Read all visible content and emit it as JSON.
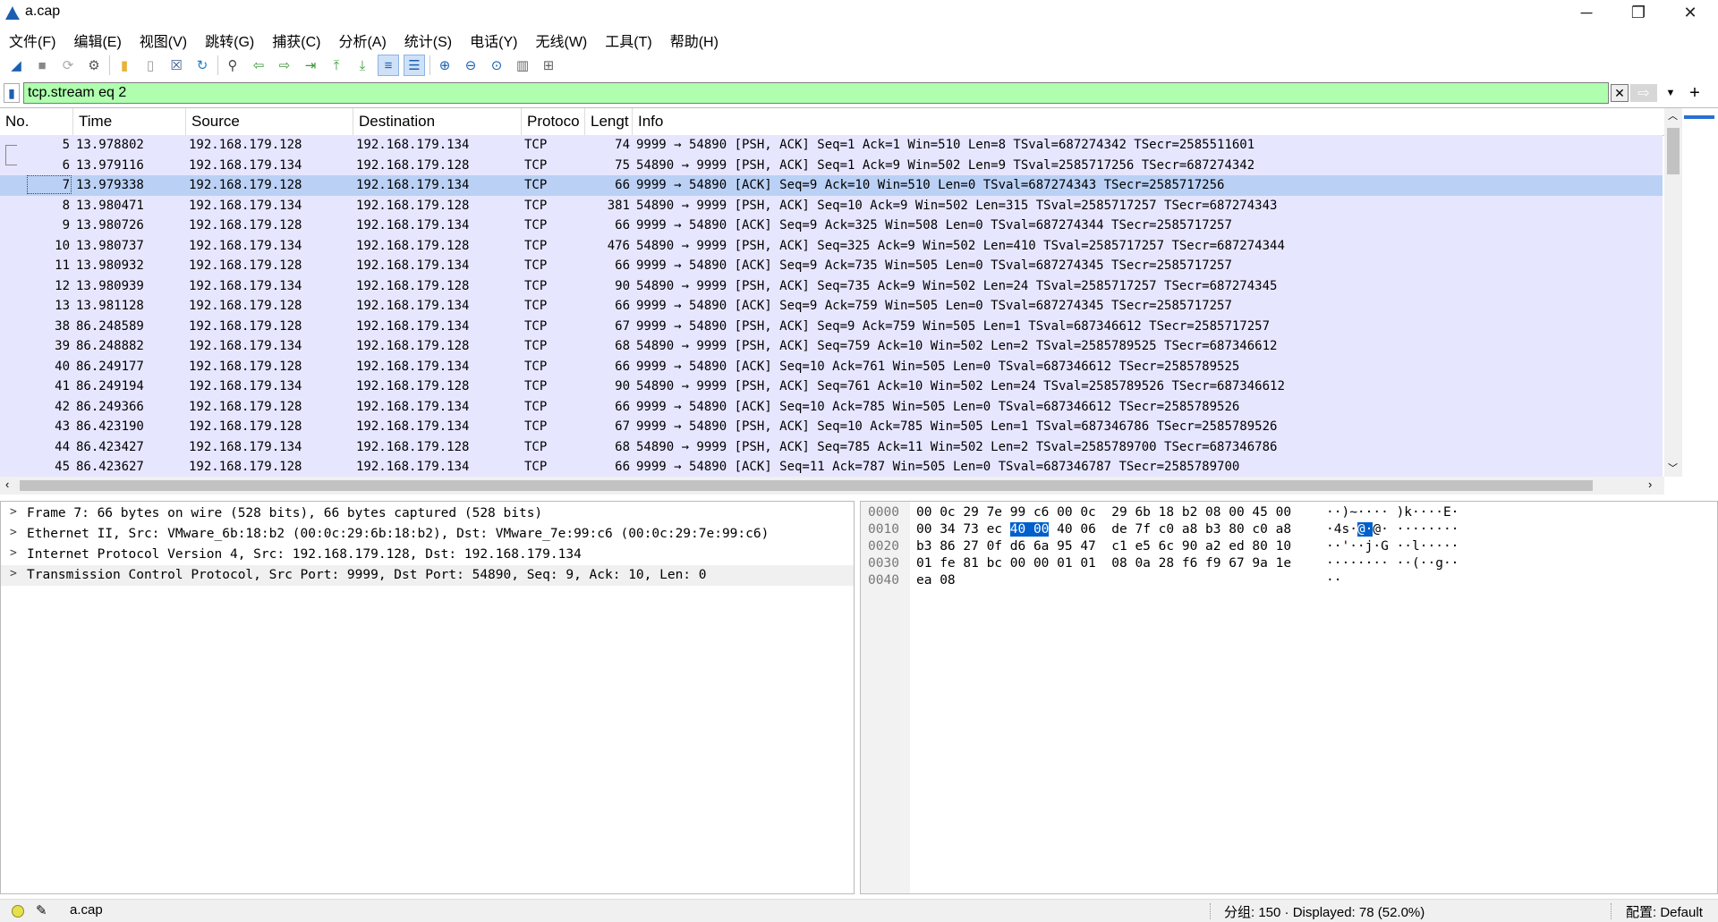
{
  "window": {
    "title": "a.cap"
  },
  "menu": [
    "文件(F)",
    "编辑(E)",
    "视图(V)",
    "跳转(G)",
    "捕获(C)",
    "分析(A)",
    "统计(S)",
    "电话(Y)",
    "无线(W)",
    "工具(T)",
    "帮助(H)"
  ],
  "filter": {
    "value": "tcp.stream eq 2",
    "bg_color": "#afffaf"
  },
  "packet_list": {
    "columns": [
      "No.",
      "Time",
      "Source",
      "Destination",
      "Protoco",
      "Lengt",
      "Info"
    ],
    "row_color": "#e7e6ff",
    "selected_color": "#bad1f5",
    "rows": [
      {
        "no": "5",
        "time": "13.978802",
        "src": "192.168.179.128",
        "dst": "192.168.179.134",
        "proto": "TCP",
        "len": "74",
        "info": "9999 → 54890 [PSH, ACK] Seq=1 Ack=1 Win=510 Len=8 TSval=687274342 TSecr=2585511601"
      },
      {
        "no": "6",
        "time": "13.979116",
        "src": "192.168.179.134",
        "dst": "192.168.179.128",
        "proto": "TCP",
        "len": "75",
        "info": "54890 → 9999 [PSH, ACK] Seq=1 Ack=9 Win=502 Len=9 TSval=2585717256 TSecr=687274342"
      },
      {
        "no": "7",
        "time": "13.979338",
        "src": "192.168.179.128",
        "dst": "192.168.179.134",
        "proto": "TCP",
        "len": "66",
        "info": "9999 → 54890 [ACK] Seq=9 Ack=10 Win=510 Len=0 TSval=687274343 TSecr=2585717256"
      },
      {
        "no": "8",
        "time": "13.980471",
        "src": "192.168.179.134",
        "dst": "192.168.179.128",
        "proto": "TCP",
        "len": "381",
        "info": "54890 → 9999 [PSH, ACK] Seq=10 Ack=9 Win=502 Len=315 TSval=2585717257 TSecr=687274343"
      },
      {
        "no": "9",
        "time": "13.980726",
        "src": "192.168.179.128",
        "dst": "192.168.179.134",
        "proto": "TCP",
        "len": "66",
        "info": "9999 → 54890 [ACK] Seq=9 Ack=325 Win=508 Len=0 TSval=687274344 TSecr=2585717257"
      },
      {
        "no": "10",
        "time": "13.980737",
        "src": "192.168.179.134",
        "dst": "192.168.179.128",
        "proto": "TCP",
        "len": "476",
        "info": "54890 → 9999 [PSH, ACK] Seq=325 Ack=9 Win=502 Len=410 TSval=2585717257 TSecr=687274344"
      },
      {
        "no": "11",
        "time": "13.980932",
        "src": "192.168.179.128",
        "dst": "192.168.179.134",
        "proto": "TCP",
        "len": "66",
        "info": "9999 → 54890 [ACK] Seq=9 Ack=735 Win=505 Len=0 TSval=687274345 TSecr=2585717257"
      },
      {
        "no": "12",
        "time": "13.980939",
        "src": "192.168.179.134",
        "dst": "192.168.179.128",
        "proto": "TCP",
        "len": "90",
        "info": "54890 → 9999 [PSH, ACK] Seq=735 Ack=9 Win=502 Len=24 TSval=2585717257 TSecr=687274345"
      },
      {
        "no": "13",
        "time": "13.981128",
        "src": "192.168.179.128",
        "dst": "192.168.179.134",
        "proto": "TCP",
        "len": "66",
        "info": "9999 → 54890 [ACK] Seq=9 Ack=759 Win=505 Len=0 TSval=687274345 TSecr=2585717257"
      },
      {
        "no": "38",
        "time": "86.248589",
        "src": "192.168.179.128",
        "dst": "192.168.179.134",
        "proto": "TCP",
        "len": "67",
        "info": "9999 → 54890 [PSH, ACK] Seq=9 Ack=759 Win=505 Len=1 TSval=687346612 TSecr=2585717257"
      },
      {
        "no": "39",
        "time": "86.248882",
        "src": "192.168.179.134",
        "dst": "192.168.179.128",
        "proto": "TCP",
        "len": "68",
        "info": "54890 → 9999 [PSH, ACK] Seq=759 Ack=10 Win=502 Len=2 TSval=2585789525 TSecr=687346612"
      },
      {
        "no": "40",
        "time": "86.249177",
        "src": "192.168.179.128",
        "dst": "192.168.179.134",
        "proto": "TCP",
        "len": "66",
        "info": "9999 → 54890 [ACK] Seq=10 Ack=761 Win=505 Len=0 TSval=687346612 TSecr=2585789525"
      },
      {
        "no": "41",
        "time": "86.249194",
        "src": "192.168.179.134",
        "dst": "192.168.179.128",
        "proto": "TCP",
        "len": "90",
        "info": "54890 → 9999 [PSH, ACK] Seq=761 Ack=10 Win=502 Len=24 TSval=2585789526 TSecr=687346612"
      },
      {
        "no": "42",
        "time": "86.249366",
        "src": "192.168.179.128",
        "dst": "192.168.179.134",
        "proto": "TCP",
        "len": "66",
        "info": "9999 → 54890 [ACK] Seq=10 Ack=785 Win=505 Len=0 TSval=687346612 TSecr=2585789526"
      },
      {
        "no": "43",
        "time": "86.423190",
        "src": "192.168.179.128",
        "dst": "192.168.179.134",
        "proto": "TCP",
        "len": "67",
        "info": "9999 → 54890 [PSH, ACK] Seq=10 Ack=785 Win=505 Len=1 TSval=687346786 TSecr=2585789526"
      },
      {
        "no": "44",
        "time": "86.423427",
        "src": "192.168.179.134",
        "dst": "192.168.179.128",
        "proto": "TCP",
        "len": "68",
        "info": "54890 → 9999 [PSH, ACK] Seq=785 Ack=11 Win=502 Len=2 TSval=2585789700 TSecr=687346786"
      },
      {
        "no": "45",
        "time": "86.423627",
        "src": "192.168.179.128",
        "dst": "192.168.179.134",
        "proto": "TCP",
        "len": "66",
        "info": "9999 → 54890 [ACK] Seq=11 Ack=787 Win=505 Len=0 TSval=687346787 TSecr=2585789700"
      }
    ],
    "selected_no": "7"
  },
  "details": [
    "Frame 7: 66 bytes on wire (528 bits), 66 bytes captured (528 bits)",
    "Ethernet II, Src: VMware_6b:18:b2 (00:0c:29:6b:18:b2), Dst: VMware_7e:99:c6 (00:0c:29:7e:99:c6)",
    "Internet Protocol Version 4, Src: 192.168.179.128, Dst: 192.168.179.134",
    "Transmission Control Protocol, Src Port: 9999, Dst Port: 54890, Seq: 9, Ack: 10, Len: 0"
  ],
  "bytes": {
    "rows": [
      {
        "offset": "0000",
        "hex_a": "00 0c 29 7e 99 c6 00 0c",
        "hex_b": "29 6b 18 b2 08 00 45 00",
        "ascii_a": "··)~····",
        "ascii_b": ")k····E·"
      },
      {
        "offset": "0010",
        "hex_a": "00 34 73 ec ",
        "hex_hl": "40 00",
        "hex_a2": " 40 06",
        "hex_b": "de 7f c0 a8 b3 80 c0 a8",
        "ascii_a": "·4s·",
        "ascii_hl": "@·",
        "ascii_a2": "@·",
        "ascii_b": "········"
      },
      {
        "offset": "0020",
        "hex_a": "b3 86 27 0f d6 6a 95 47",
        "hex_b": "c1 e5 6c 90 a2 ed 80 10",
        "ascii_a": "··'··j·G",
        "ascii_b": "··l·····"
      },
      {
        "offset": "0030",
        "hex_a": "01 fe 81 bc 00 00 01 01",
        "hex_b": "08 0a 28 f6 f9 67 9a 1e",
        "ascii_a": "········",
        "ascii_b": "··(··g··"
      },
      {
        "offset": "0040",
        "hex_a": "ea 08",
        "hex_b": "",
        "ascii_a": "··",
        "ascii_b": ""
      }
    ],
    "highlight_color": "#0060cc"
  },
  "status": {
    "file": "a.cap",
    "stats": "分组: 150 · Displayed: 78 (52.0%)",
    "profile": "配置: Default"
  }
}
